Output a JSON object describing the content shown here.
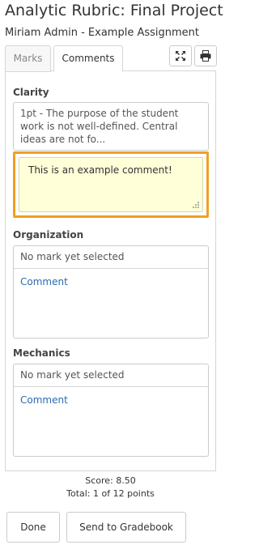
{
  "header": {
    "title": "Analytic Rubric: Final Project",
    "subtitle": "Miriam Admin - Example Assignment"
  },
  "tabs": [
    {
      "label": "Marks",
      "active": false
    },
    {
      "label": "Comments",
      "active": true
    }
  ],
  "toolbar": {
    "expand_icon": "expand-icon",
    "print_icon": "print-icon"
  },
  "sections": [
    {
      "label": "Clarity",
      "mark_text": "1pt - The purpose of the student work is not well-defined. Central ideas are not fo...",
      "comment_value": "This is an example comment!"
    },
    {
      "label": "Organization",
      "mark_text": "No mark yet selected",
      "comment_link": "Comment"
    },
    {
      "label": "Mechanics",
      "mark_text": "No mark yet selected",
      "comment_link": "Comment"
    }
  ],
  "score": {
    "score_line": "Score: 8.50",
    "total_line": "Total: 1 of 12 points"
  },
  "buttons": {
    "done": "Done",
    "send": "Send to Gradebook"
  },
  "colors": {
    "highlight_border": "#f0a020",
    "comment_background": "#ffffd8",
    "link": "#2a6bb0"
  }
}
